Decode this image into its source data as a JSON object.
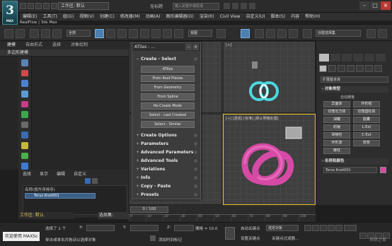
{
  "app": {
    "logo_text": "3",
    "logo_sub": "MAX",
    "workspace_label": "工作区: 默认",
    "window_title": "无标题",
    "search_placeholder": "键入关键字或短语"
  },
  "menubar": [
    "编辑(E)",
    "工具(T)",
    "组(G)",
    "视图(V)",
    "创建(C)",
    "修改器(M)",
    "动画(A)",
    "图形编辑器(D)",
    "渲染(R)",
    "Civil View",
    "自定义(U)",
    "脚本(S)",
    "内容",
    "帮助(H)"
  ],
  "toolbar": {
    "filter_value": "全部",
    "view_value": "视图",
    "named_sel_placeholder": "创建选择集"
  },
  "ribbon": {
    "tabs": [
      "建模",
      "自由形式",
      "选择",
      "对象绘制"
    ],
    "extra": [
      "RealFlow",
      "3ds Max"
    ],
    "active_sub": "多边形建模"
  },
  "atiles": {
    "title": "ATiles - ...",
    "sections": {
      "create_select": "Create - Select",
      "create_options": "Create Options",
      "parameters": "Parameters",
      "advanced_parameters": "Advanced Parameters",
      "advanced_tools": "Advanced Tools",
      "variations": "Variations",
      "info": "Info",
      "copy_paste": "Copy - Paste",
      "presets": "Presets"
    },
    "buttons": {
      "atiles": "ATiles",
      "from_roof_planes": "From Roof Planes",
      "from_geometry": "From Geometry",
      "from_spline": "From Spline",
      "re_create_mode": "Re-Create Mode",
      "select_last_created": "Select - Last Created",
      "select_similar": "Select - Similar"
    }
  },
  "viewport_perspective_label": "[+] [透视] [标准] [默认明暗处理]",
  "viewport_front_label": "[+]",
  "right_panel": {
    "category_dropdown": "扩展基本体",
    "object_type_title": "对象类型",
    "autogrid": "自动栅格",
    "buttons": [
      "异面体",
      "环形结",
      "切角长方体",
      "切角圆柱体",
      "油罐",
      "胶囊",
      "纺锤",
      "L-Ext",
      "球棱柱",
      "C-Ext",
      "环形波",
      "软管",
      "棱柱"
    ],
    "name_color_title": "名称和颜色",
    "object_name": "Torus Knot001"
  },
  "scene_explorer": {
    "tabs": [
      "选择",
      "显示",
      "编辑",
      "自定义"
    ],
    "column_header": "名称(按升序排序)",
    "rows": [
      "Torus Knot001"
    ]
  },
  "bottom": {
    "workspace_status": "工作区: 默认",
    "selection_set": "选择集:",
    "time_slider": "0 / 100",
    "ticks": [
      "0",
      "10",
      "20",
      "30",
      "40",
      "50",
      "60",
      "70",
      "80",
      "90",
      "100"
    ],
    "selected_count": "选择了 1 个",
    "x_label": "X:",
    "y_label": "Y:",
    "z_label": "Z:",
    "grid_label": "栅格 = 10.0",
    "auto_key": "自动关键点",
    "set_key": "设置关键点",
    "selected_dropdown": "选定对象",
    "key_filters": "关键点过滤器...",
    "add_time_tag": "添加时间标记",
    "hint": "单击或单击并拖动以选择对象"
  },
  "watermarks": {
    "left": "欢迎使用 MAXSc",
    "right": "系统之家"
  },
  "colors": {
    "accent_blue": "#4a7fb0",
    "selection_yellow": "#e8c020",
    "torus_magenta": "#d64aa6",
    "teal_object": "#4ad8e0"
  }
}
